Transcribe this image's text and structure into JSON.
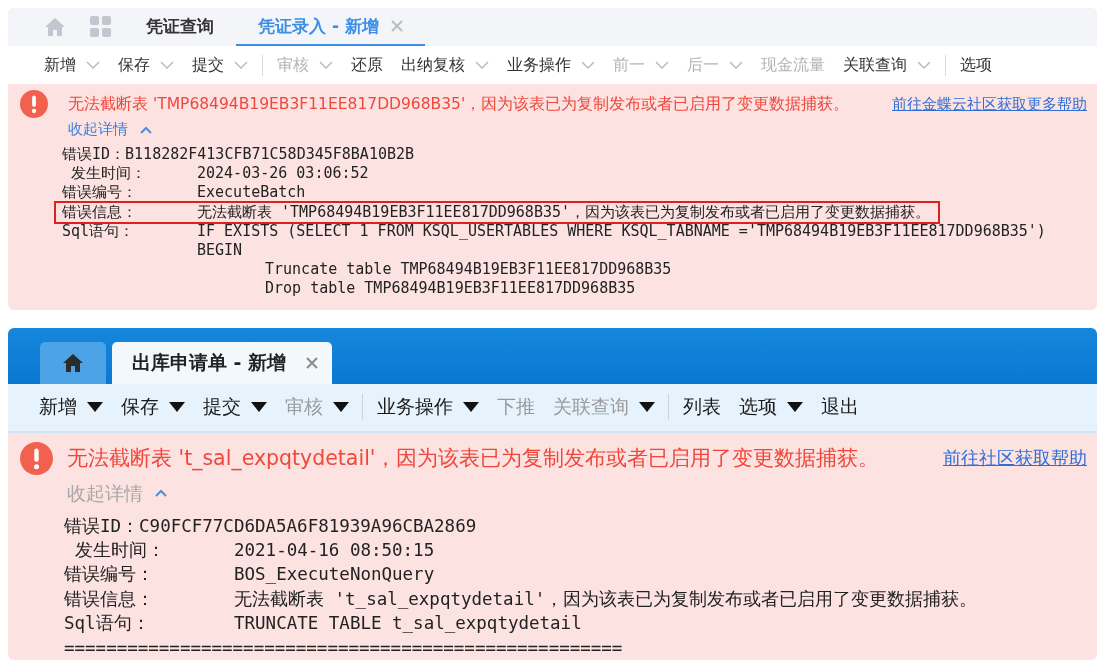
{
  "panels": [
    {
      "kind": "light",
      "tabs": [
        {
          "kind": "home",
          "selected": false
        },
        {
          "kind": "grid",
          "selected": false
        },
        {
          "kind": "label",
          "label": "凭证查询",
          "selected": false,
          "closable": false
        },
        {
          "kind": "label",
          "label": "凭证录入 - 新增",
          "selected": true,
          "closable": true
        }
      ],
      "toolbar": [
        {
          "label": "新增",
          "disabled": false,
          "dropdown": true,
          "divider_before": false
        },
        {
          "label": "保存",
          "disabled": false,
          "dropdown": true,
          "divider_before": false
        },
        {
          "label": "提交",
          "disabled": false,
          "dropdown": true,
          "divider_before": false
        },
        {
          "label": "审核",
          "disabled": true,
          "dropdown": true,
          "divider_before": true
        },
        {
          "label": "还原",
          "disabled": false,
          "dropdown": false,
          "divider_before": false
        },
        {
          "label": "出纳复核",
          "disabled": false,
          "dropdown": true,
          "divider_before": false
        },
        {
          "label": "业务操作",
          "disabled": false,
          "dropdown": true,
          "divider_before": false
        },
        {
          "label": "前一",
          "disabled": true,
          "dropdown": true,
          "divider_before": false
        },
        {
          "label": "后一",
          "disabled": true,
          "dropdown": true,
          "divider_before": false
        },
        {
          "label": "现金流量",
          "disabled": true,
          "dropdown": false,
          "divider_before": false
        },
        {
          "label": "关联查询",
          "disabled": false,
          "dropdown": true,
          "divider_before": false
        },
        {
          "label": "选项",
          "disabled": false,
          "dropdown": false,
          "divider_before": true
        }
      ],
      "error": {
        "message": "无法截断表 'TMP68494B19EB3F11EE817DD968B35'，因为该表已为复制发布或者已启用了变更数据捕获。",
        "help_link": "前往金蝶云社区获取更多帮助",
        "collapse_label": "收起详情",
        "details": [
          {
            "kind": "inline",
            "label": "错误ID：",
            "value": "B118282F413CFB71C58D345F8BA10B2B"
          },
          {
            "kind": "column",
            "label": " 发生时间：",
            "value": "2024-03-26 03:06:52",
            "highlighted": false
          },
          {
            "kind": "column",
            "label": "错误编号：",
            "value": "ExecuteBatch",
            "highlighted": false
          },
          {
            "kind": "column",
            "label": "错误信息：",
            "value": "无法截断表 'TMP68494B19EB3F11EE817DD968B35'，因为该表已为复制发布或者已启用了变更数据捕获。",
            "highlighted": true
          },
          {
            "kind": "column",
            "label": "Sql语句：",
            "value": "IF EXISTS (SELECT 1 FROM KSQL_USERTABLES WHERE KSQL_TABNAME ='TMP68494B19EB3F11EE817DD968B35')",
            "highlighted": false,
            "children": [
              {
                "text": "BEGIN",
                "children": [
                  {
                    "text": "Truncate table TMP68494B19EB3F11EE817DD968B35"
                  },
                  {
                    "text": "Drop table TMP68494B19EB3F11EE817DD968B35"
                  }
                ]
              }
            ]
          }
        ]
      }
    },
    {
      "kind": "blue",
      "tabs": [
        {
          "kind": "home",
          "selected": false
        },
        {
          "kind": "label",
          "label": "出库申请单 - 新增",
          "selected": true,
          "closable": true
        }
      ],
      "toolbar": [
        {
          "label": "新增",
          "disabled": false,
          "dropdown": true,
          "divider_before": false
        },
        {
          "label": "保存",
          "disabled": false,
          "dropdown": true,
          "divider_before": false
        },
        {
          "label": "提交",
          "disabled": false,
          "dropdown": true,
          "divider_before": false
        },
        {
          "label": "审核",
          "disabled": true,
          "dropdown": true,
          "divider_before": false
        },
        {
          "label": "业务操作",
          "disabled": false,
          "dropdown": true,
          "divider_before": true
        },
        {
          "label": "下推",
          "disabled": true,
          "dropdown": false,
          "divider_before": false
        },
        {
          "label": "关联查询",
          "disabled": true,
          "dropdown": true,
          "divider_before": false
        },
        {
          "label": "列表",
          "disabled": false,
          "dropdown": false,
          "divider_before": true
        },
        {
          "label": "选项",
          "disabled": false,
          "dropdown": true,
          "divider_before": false
        },
        {
          "label": "退出",
          "disabled": false,
          "dropdown": false,
          "divider_before": false
        }
      ],
      "error": {
        "message": "无法截断表 't_sal_expqtydetail'，因为该表已为复制发布或者已启用了变更数据捕获。",
        "help_link": "前往社区获取帮助",
        "collapse_label": "收起详情",
        "details": [
          {
            "kind": "inline",
            "label": "错误ID：",
            "value": "C90FCF77CD6DA5A6F81939A96CBA2869"
          },
          {
            "kind": "column",
            "label": " 发生时间：",
            "value": "2021-04-16 08:50:15",
            "highlighted": false
          },
          {
            "kind": "column",
            "label": "错误编号：",
            "value": "BOS_ExecuteNonQuery",
            "highlighted": false
          },
          {
            "kind": "column",
            "label": "错误信息：",
            "value": "无法截断表 't_sal_expqtydetail'，因为该表已为复制发布或者已启用了变更数据捕获。",
            "highlighted": false
          },
          {
            "kind": "column",
            "label": "Sql语句：",
            "value": "TRUNCATE TABLE t_sal_expqtydetail",
            "highlighted": false
          },
          {
            "kind": "rule",
            "text": "====================================================="
          }
        ]
      }
    }
  ]
}
